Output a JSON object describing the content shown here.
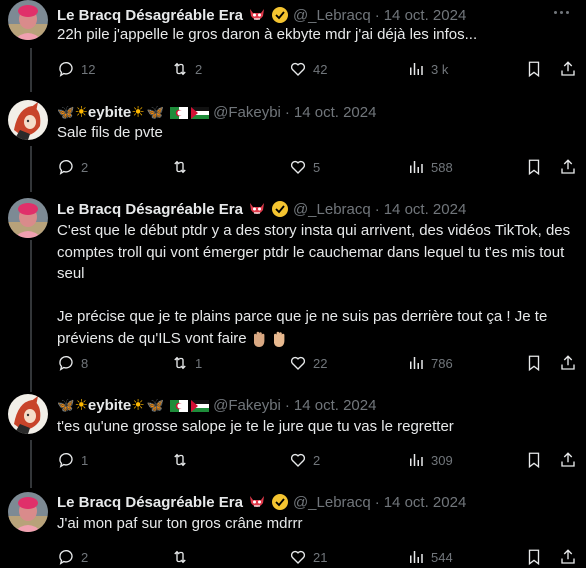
{
  "posts": [
    {
      "name": "Le Bracq Désagréable Era",
      "handle": "@_Lebracq",
      "date": "14 oct. 2024",
      "text": "22h pile j'appelle le gros daron à ekbyte mdr j'ai déjà les infos...",
      "replies": "12",
      "reposts": "2",
      "likes": "42",
      "views": "3 k"
    },
    {
      "name": "eybite",
      "handle": "@Fakeybi",
      "date": "14 oct. 2024",
      "text": "Sale fils de pvte",
      "replies": "2",
      "reposts": "",
      "likes": "5",
      "views": "588"
    },
    {
      "name": "Le Bracq Désagréable Era",
      "handle": "@_Lebracq",
      "date": "14 oct. 2024",
      "text": "C'est que le début ptdr y a des story insta qui arrivent, des vidéos TikTok, des comptes troll qui vont émerger ptdr le cauchemar dans lequel tu t'es mis tout seul\n\nJe précise que je te plains parce que je ne suis pas derrière tout ça ! Je te préviens de qu'ILS vont faire",
      "replies": "8",
      "reposts": "1",
      "likes": "22",
      "views": "786"
    },
    {
      "name": "eybite",
      "handle": "@Fakeybi",
      "date": "14 oct. 2024",
      "text": "t'es qu'une grosse salope je te le jure que tu vas le regretter",
      "replies": "1",
      "reposts": "",
      "likes": "2",
      "views": "309"
    },
    {
      "name": "Le Bracq Désagréable Era",
      "handle": "@_Lebracq",
      "date": "14 oct. 2024",
      "text": "J'ai mon paf sur ton gros crâne mdrrr",
      "replies": "2",
      "reposts": "",
      "likes": "21",
      "views": "544"
    }
  ],
  "colors": {
    "accent_verified": "#f4c430",
    "text_muted": "#71767b",
    "background": "#000000"
  }
}
